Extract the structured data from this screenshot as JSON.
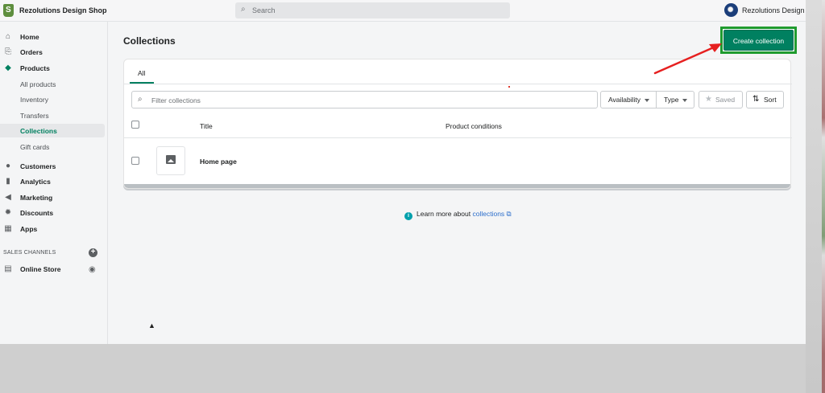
{
  "topbar": {
    "store_name": "Rezolutions Design Shop",
    "search_placeholder": "Search",
    "account_name": "Rezolutions Design"
  },
  "sidebar": {
    "items": [
      {
        "label": "Home",
        "icon": "home-icon"
      },
      {
        "label": "Orders",
        "icon": "orders-icon"
      },
      {
        "label": "Products",
        "icon": "tag-icon"
      },
      {
        "label": "Customers",
        "icon": "person-icon"
      },
      {
        "label": "Analytics",
        "icon": "bar-chart-icon"
      },
      {
        "label": "Marketing",
        "icon": "megaphone-icon"
      },
      {
        "label": "Discounts",
        "icon": "discount-icon"
      },
      {
        "label": "Apps",
        "icon": "apps-icon"
      }
    ],
    "product_subitems": [
      "All products",
      "Inventory",
      "Transfers",
      "Collections",
      "Gift cards"
    ],
    "active_subitem": "Collections",
    "channels_label": "SALES CHANNELS",
    "online_store": "Online Store"
  },
  "main": {
    "page_title": "Collections",
    "create_button": "Create collection",
    "tab_all": "All",
    "filter_placeholder": "Filter collections",
    "availability": "Availability",
    "type": "Type",
    "saved": "Saved",
    "sort": "Sort",
    "columns": {
      "title": "Title",
      "conditions": "Product conditions"
    },
    "rows": [
      {
        "title": "Home page"
      }
    ],
    "learn_more_prefix": "Learn more about",
    "learn_more_link": "collections"
  },
  "colors": {
    "primary": "#008060",
    "highlight_outline": "#1f9b2f",
    "annotation_arrow": "#e62020",
    "link": "#2c6ecb"
  }
}
